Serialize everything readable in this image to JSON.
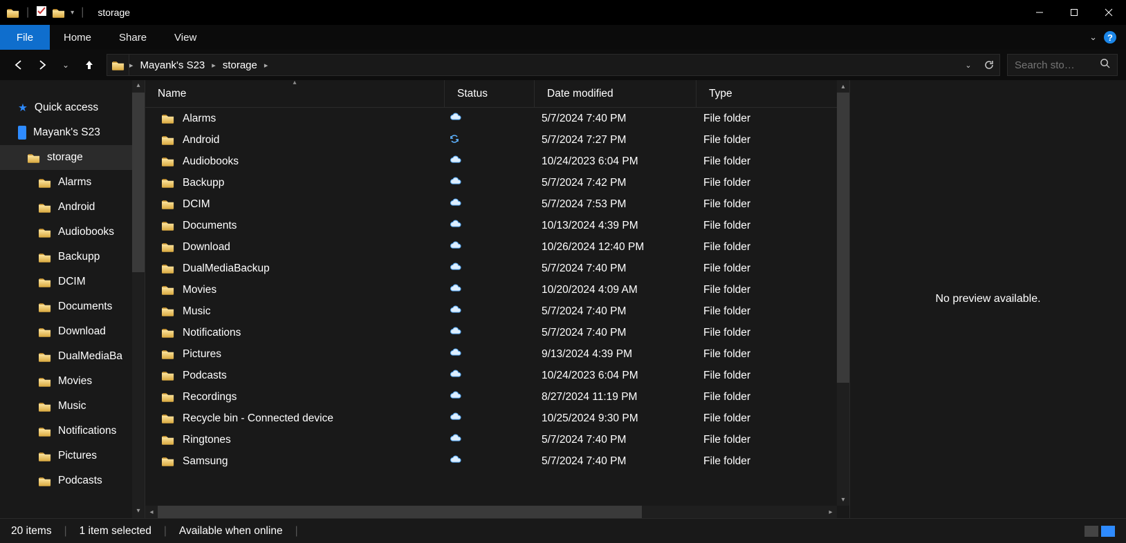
{
  "window": {
    "title": "storage"
  },
  "ribbon": {
    "file": "File",
    "tabs": [
      "Home",
      "Share",
      "View"
    ]
  },
  "breadcrumb": {
    "items": [
      "Mayank's S23",
      "storage"
    ]
  },
  "search": {
    "placeholder": "Search sto…"
  },
  "sidebar": {
    "quick_access": "Quick access",
    "device": "Mayank's S23",
    "current": "storage",
    "children": [
      "Alarms",
      "Android",
      "Audiobooks",
      "Backupp",
      "DCIM",
      "Documents",
      "Download",
      "DualMediaBa",
      "Movies",
      "Music",
      "Notifications",
      "Pictures",
      "Podcasts"
    ]
  },
  "columns": {
    "name": "Name",
    "status": "Status",
    "date": "Date modified",
    "type": "Type"
  },
  "rows": [
    {
      "name": "Alarms",
      "status": "cloud",
      "date": "5/7/2024 7:40 PM",
      "type": "File folder"
    },
    {
      "name": "Android",
      "status": "sync",
      "date": "5/7/2024 7:27 PM",
      "type": "File folder"
    },
    {
      "name": "Audiobooks",
      "status": "cloud",
      "date": "10/24/2023 6:04 PM",
      "type": "File folder"
    },
    {
      "name": "Backupp",
      "status": "cloud",
      "date": "5/7/2024 7:42 PM",
      "type": "File folder"
    },
    {
      "name": "DCIM",
      "status": "cloud",
      "date": "5/7/2024 7:53 PM",
      "type": "File folder"
    },
    {
      "name": "Documents",
      "status": "cloud",
      "date": "10/13/2024 4:39 PM",
      "type": "File folder"
    },
    {
      "name": "Download",
      "status": "cloud",
      "date": "10/26/2024 12:40 PM",
      "type": "File folder"
    },
    {
      "name": "DualMediaBackup",
      "status": "cloud",
      "date": "5/7/2024 7:40 PM",
      "type": "File folder"
    },
    {
      "name": "Movies",
      "status": "cloud",
      "date": "10/20/2024 4:09 AM",
      "type": "File folder"
    },
    {
      "name": "Music",
      "status": "cloud",
      "date": "5/7/2024 7:40 PM",
      "type": "File folder"
    },
    {
      "name": "Notifications",
      "status": "cloud",
      "date": "5/7/2024 7:40 PM",
      "type": "File folder"
    },
    {
      "name": "Pictures",
      "status": "cloud",
      "date": "9/13/2024 4:39 PM",
      "type": "File folder"
    },
    {
      "name": "Podcasts",
      "status": "cloud",
      "date": "10/24/2023 6:04 PM",
      "type": "File folder"
    },
    {
      "name": "Recordings",
      "status": "cloud",
      "date": "8/27/2024 11:19 PM",
      "type": "File folder"
    },
    {
      "name": "Recycle bin - Connected device",
      "status": "cloud",
      "date": "10/25/2024 9:30 PM",
      "type": "File folder"
    },
    {
      "name": "Ringtones",
      "status": "cloud",
      "date": "5/7/2024 7:40 PM",
      "type": "File folder"
    },
    {
      "name": "Samsung",
      "status": "cloud",
      "date": "5/7/2024 7:40 PM",
      "type": "File folder"
    }
  ],
  "preview": {
    "msg": "No preview available."
  },
  "status": {
    "items": "20 items",
    "selected": "1 item selected",
    "availability": "Available when online"
  }
}
